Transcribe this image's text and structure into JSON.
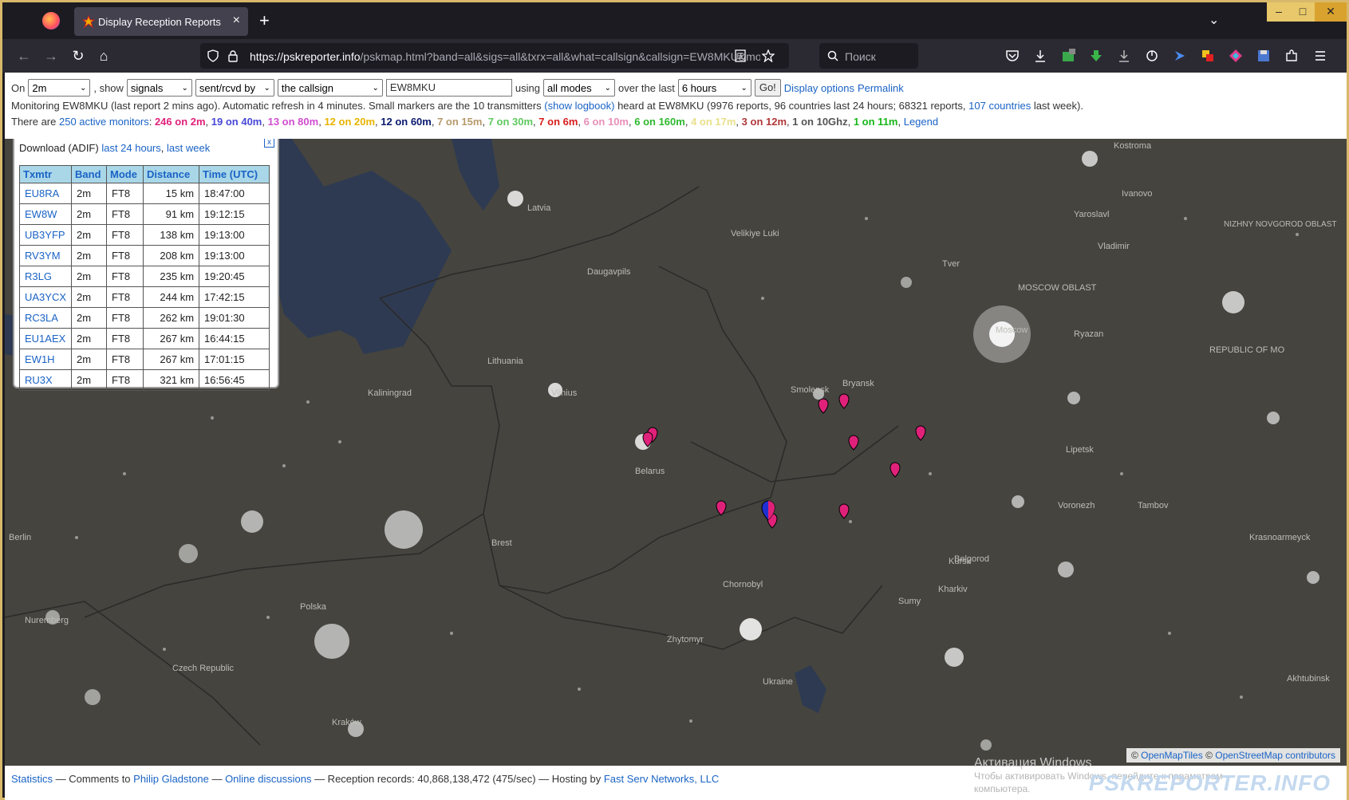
{
  "browser": {
    "tab_title": "Display Reception Reports",
    "url_host": "https://pskreporter.info",
    "url_path": "/pskmap.html?band=all&sigs=all&txrx=all&what=callsign&callsign=EW8MKU&mo",
    "search_placeholder": "Поиск",
    "tab_close": "×",
    "new_tab": "+",
    "tab_list": "⌄",
    "win_min": "–",
    "win_max": "□",
    "win_close": "✕"
  },
  "controls": {
    "on_label": "On",
    "band_value": "2m",
    "show_label": ", show",
    "signals_value": "signals",
    "direction_value": "sent/rcvd by",
    "what_value": "the callsign",
    "callsign_value": "EW8MKU",
    "using_label": "using",
    "modes_value": "all modes",
    "over_label": "over the last",
    "period_value": "6 hours",
    "go_label": "Go!",
    "display_options": "Display options",
    "permalink": "Permalink"
  },
  "monitoring": {
    "text1": "Monitoring EW8MKU (last report 2 mins ago). Automatic refresh in 4 minutes. Small markers are the 10 transmitters ",
    "show_logbook": "(show logbook)",
    "text2": " heard at EW8MKU (9976 reports, 96 countries last 24 hours; 68321 reports, ",
    "countries_link": "107 countries",
    "text3": " last week)."
  },
  "monitors": {
    "prefix": "There are ",
    "active_link": "250 active monitors",
    "colon": ": ",
    "bands": [
      {
        "text": "246 on 2m",
        "color": "#e0217a"
      },
      {
        "text": "19 on 40m",
        "color": "#4848d8"
      },
      {
        "text": "13 on 80m",
        "color": "#d14dd1"
      },
      {
        "text": "12 on 20m",
        "color": "#e8b400"
      },
      {
        "text": "12 on 60m",
        "color": "#0a1a6e"
      },
      {
        "text": "7 on 15m",
        "color": "#b59a6c"
      },
      {
        "text": "7 on 30m",
        "color": "#5fc95f"
      },
      {
        "text": "7 on 6m",
        "color": "#d81e1e"
      },
      {
        "text": "6 on 10m",
        "color": "#e890b8"
      },
      {
        "text": "6 on 160m",
        "color": "#2eb82e"
      },
      {
        "text": "4 on 17m",
        "color": "#e8e08a"
      },
      {
        "text": "3 on 12m",
        "color": "#b03838"
      },
      {
        "text": "1 on 10Ghz",
        "color": "#555555"
      },
      {
        "text": "1 on 11m",
        "color": "#18b818"
      }
    ],
    "legend": "Legend"
  },
  "panel": {
    "download_label": "Download (ADIF)",
    "last24": "last 24 hours",
    "lastweek": "last week",
    "close": "x",
    "headers": [
      "Txmtr",
      "Band",
      "Mode",
      "Distance",
      "Time (UTC)"
    ],
    "rows": [
      [
        "EU8RA",
        "2m",
        "FT8",
        "15 km",
        "18:47:00"
      ],
      [
        "EW8W",
        "2m",
        "FT8",
        "91 km",
        "19:12:15"
      ],
      [
        "UB3YFP",
        "2m",
        "FT8",
        "138 km",
        "19:13:00"
      ],
      [
        "RV3YM",
        "2m",
        "FT8",
        "208 km",
        "19:13:00"
      ],
      [
        "R3LG",
        "2m",
        "FT8",
        "235 km",
        "19:20:45"
      ],
      [
        "UA3YCX",
        "2m",
        "FT8",
        "244 km",
        "17:42:15"
      ],
      [
        "RC3LA",
        "2m",
        "FT8",
        "262 km",
        "19:01:30"
      ],
      [
        "EU1AEX",
        "2m",
        "FT8",
        "267 km",
        "16:44:15"
      ],
      [
        "EW1H",
        "2m",
        "FT8",
        "267 km",
        "17:01:15"
      ],
      [
        "RU3X",
        "2m",
        "FT8",
        "321 km",
        "16:56:45"
      ]
    ]
  },
  "map": {
    "labels": [
      "Latvia",
      "Lithuania",
      "Daugavpils",
      "Velikiye Luki",
      "Vilnius",
      "Smolensk",
      "Belarus",
      "Moscow",
      "Chornobyl",
      "Zhytomyr",
      "Ukraine",
      "Kursk",
      "Sumy",
      "Tambov",
      "Czech Republic",
      "Kraków",
      "Kaliningrad",
      "Brest",
      "Bryansk",
      "Tver",
      "Yaroslavl",
      "Kostroma",
      "Ivanovo",
      "Vladimir",
      "Ryazan",
      "Lipetsk",
      "Voronezh",
      "Belgorod",
      "Kharkiv",
      "Krasnoarmeyck",
      "NIZHNY NOVGOROD OBLAST",
      "REPUBLIC OF MO",
      "MOSCOW OBLAST",
      "Akhtubinsk",
      "Nuremberg",
      "Berlin",
      "Polska"
    ],
    "land_color": "#45443f",
    "water_color": "#2e3a52"
  },
  "attribution": {
    "copy1": "© ",
    "omt": "OpenMapTiles",
    "copy2": " © ",
    "osm": "OpenStreetMap contributors"
  },
  "win_activation": {
    "line1": "Активация Windows",
    "line2": "Чтобы активировать Windows, перейдите к параметрам",
    "line3": "компьютера."
  },
  "footer": {
    "statistics": "Statistics",
    "sep1": " — Comments to ",
    "author": "Philip Gladstone",
    "sep2": " — ",
    "discussions": "Online discussions",
    "records": " — Reception records: 40,868,138,472 (475/sec) — Hosting by ",
    "host": "Fast Serv Networks, LLC",
    "brand": "PSKREPORTER.INFO"
  }
}
